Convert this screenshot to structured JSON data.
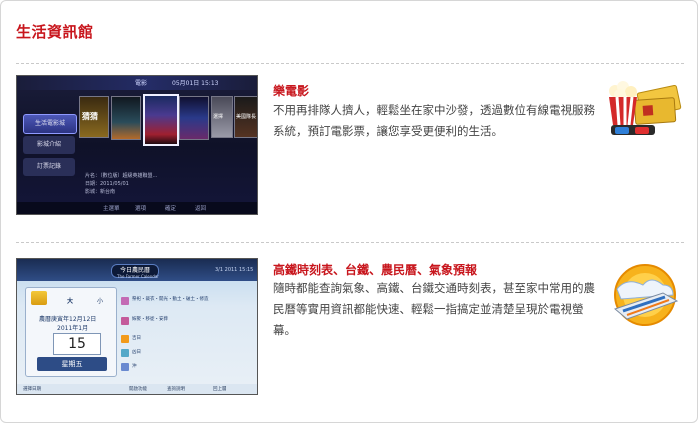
{
  "page": {
    "title": "生活資訊館"
  },
  "sections": [
    {
      "title": "樂電影",
      "description": "不用再排隊人擠人，輕鬆坐在家中沙發，透過數位有線電視服務系統，預訂電影票，讓您享受更便利的生活。",
      "decoration_icon": "movie-popcorn-tickets-3d-glasses",
      "screenshot": {
        "tab": "電影",
        "datetime": "05月01日 15:13",
        "menu_items": [
          "生活電影城",
          "影城介紹",
          "訂票記錄"
        ],
        "cover_label_1": "猜猜",
        "cover_label_2": "選擇",
        "cover_label_3": "美國隊長",
        "info_lines": [
          "片名：（數位版）超級英雄聯盟...",
          "日期：2011/05/01",
          "影城：新台南"
        ],
        "footer_items": [
          "主選單",
          "選項",
          "確定",
          "返回"
        ]
      }
    },
    {
      "title": "高鐵時刻表、台鐵、農民曆、氣象預報",
      "description": "隨時都能查詢氣象、高鐵、台鐵交通時刻表，甚至家中常用的農民曆等實用資訊都能快速、輕鬆一指搞定並清楚呈現於電視螢幕。",
      "decoration_icon": "weather-sun-cloud-train",
      "screenshot": {
        "header_title": "今日農民曆",
        "header_subtitle": "The Farmer Calendar",
        "header_time": "3/1 2011 15:15",
        "size_big": "大",
        "size_small": "小",
        "lunar": "農曆庚寅年12月12日",
        "solar": "2011年1月",
        "day_number": "15",
        "weekday": "星期五",
        "rows": [
          "祭祀・裁衣・開光・動土・破土・修造",
          "嫁娶・移徙・安葬",
          "吉日",
          "凶日",
          "沖"
        ],
        "footer_items": [
          "選擇日期",
          "開啟功能",
          "查詢說明",
          "回上層"
        ]
      }
    }
  ]
}
